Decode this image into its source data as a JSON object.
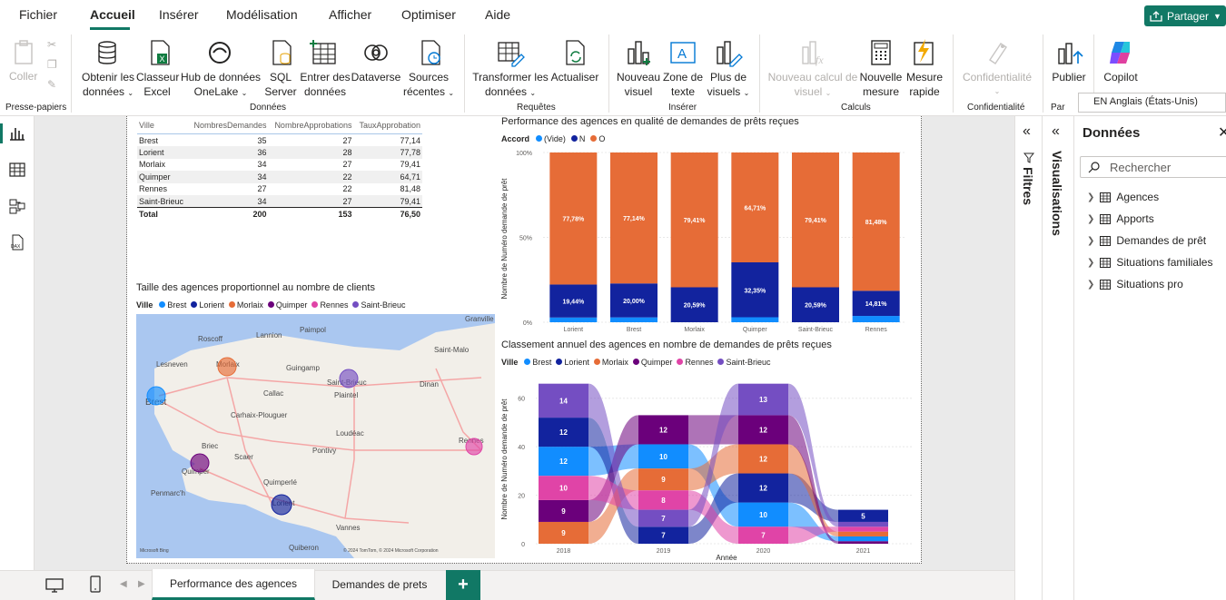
{
  "menu": {
    "items": [
      "Fichier",
      "Accueil",
      "Insérer",
      "Modélisation",
      "Afficher",
      "Optimiser",
      "Aide"
    ],
    "active": "Accueil",
    "share_label": "Partager"
  },
  "ribbon": {
    "coller": "Coller",
    "obtenir": [
      "Obtenir les",
      "données"
    ],
    "classeur": [
      "Classeur",
      "Excel"
    ],
    "hub": [
      "Hub de données",
      "OneLake"
    ],
    "sql": [
      "SQL",
      "Server"
    ],
    "entrer": [
      "Entrer des",
      "données"
    ],
    "dataverse": "Dataverse",
    "sources": [
      "Sources",
      "récentes"
    ],
    "transformer": [
      "Transformer les",
      "données"
    ],
    "actualiser": "Actualiser",
    "nouveau_visuel": [
      "Nouveau",
      "visuel"
    ],
    "zone_texte": [
      "Zone de",
      "texte"
    ],
    "plus_visuels": [
      "Plus de",
      "visuels"
    ],
    "nouveau_calcul": [
      "Nouveau calcul de",
      "visuel"
    ],
    "nouvelle_mesure": [
      "Nouvelle",
      "mesure"
    ],
    "mesure_rapide": [
      "Mesure",
      "rapide"
    ],
    "confidentialite": "Confidentialité",
    "publier": "Publier",
    "copilot": "Copilot",
    "groups": {
      "presse": "Presse-papiers",
      "donnees": "Données",
      "requetes": "Requêtes",
      "inserer": "Insérer",
      "calculs": "Calculs",
      "confidentialite": "Confidentialité",
      "par": "Par"
    },
    "language": "EN Anglais (États-Unis)"
  },
  "table": {
    "headers": [
      "Ville",
      "NombresDemandes",
      "NombreApprobations",
      "TauxApprobation"
    ],
    "rows": [
      [
        "Brest",
        "35",
        "27",
        "77,14"
      ],
      [
        "Lorient",
        "36",
        "28",
        "77,78"
      ],
      [
        "Morlaix",
        "34",
        "27",
        "79,41"
      ],
      [
        "Quimper",
        "34",
        "22",
        "64,71"
      ],
      [
        "Rennes",
        "27",
        "22",
        "81,48"
      ],
      [
        "Saint-Brieuc",
        "34",
        "27",
        "79,41"
      ]
    ],
    "total": [
      "Total",
      "200",
      "153",
      "76,50"
    ]
  },
  "map": {
    "title": "Taille des agences proportionnel au nombre de clients",
    "legend_title": "Ville",
    "places": [
      "Granville",
      "Roscoff",
      "Lannion",
      "Paimpol",
      "Saint-Malo",
      "Lesneven",
      "Morlaix",
      "Guingamp",
      "Saint-Brieuc",
      "Dinan",
      "Brest",
      "Callac",
      "Plaintel",
      "Carhaix-Plouguer",
      "Loudéac",
      "Briec",
      "Scaer",
      "Pontivy",
      "Quimper",
      "Penmarc'h",
      "Quimperlé",
      "Lorient",
      "Vannes",
      "Quiberon",
      "Rennes"
    ],
    "attribution": "© 2024 TomTom, © 2024 Microsoft Corporation",
    "logo": "Microsoft Bing"
  },
  "cities": [
    {
      "name": "Brest",
      "color": "#118dff"
    },
    {
      "name": "Lorient",
      "color": "#12239e"
    },
    {
      "name": "Morlaix",
      "color": "#e66c37"
    },
    {
      "name": "Quimper",
      "color": "#6b007b"
    },
    {
      "name": "Rennes",
      "color": "#e044a7"
    },
    {
      "name": "Saint-Brieuc",
      "color": "#744ec2"
    }
  ],
  "bar_chart": {
    "title": "Performance des agences en qualité de demandes de prêts reçues",
    "legend_title": "Accord",
    "legend": [
      {
        "name": "(Vide)",
        "color": "#118dff"
      },
      {
        "name": "N",
        "color": "#12239e"
      },
      {
        "name": "O",
        "color": "#e66c37"
      }
    ],
    "ylabel": "Nombre de Numéro demande de prêt",
    "yticks": [
      "100%",
      "50%",
      "0%"
    ]
  },
  "ribbon_chart": {
    "title": "Classement annuel des agences en nombre de demandes de prêts reçues",
    "legend_title": "Ville",
    "ylabel": "Nombre de Numéro demande de prêt",
    "xlabel": "Année",
    "yticks": [
      "60",
      "40",
      "20",
      "0"
    ]
  },
  "chart_data": [
    {
      "type": "bar",
      "title": "Performance des agences en qualité de demandes de prêts reçues",
      "categories": [
        "Lorient",
        "Brest",
        "Morlaix",
        "Quimper",
        "Saint-Brieuc",
        "Rennes"
      ],
      "series": [
        {
          "name": "(Vide)",
          "values": [
            2.78,
            2.86,
            0,
            2.94,
            0,
            3.71
          ]
        },
        {
          "name": "N",
          "values": [
            19.44,
            20.0,
            20.59,
            32.35,
            20.59,
            14.81
          ]
        },
        {
          "name": "O",
          "values": [
            77.78,
            77.14,
            79.41,
            64.71,
            79.41,
            81.48
          ]
        }
      ],
      "data_labels": {
        "N": [
          "19,44%",
          "20,00%",
          "20,59%",
          "32,35%",
          "20,59%",
          "14,81%"
        ],
        "O": [
          "77,78%",
          "77,14%",
          "79,41%",
          "64,71%",
          "79,41%",
          "81,48%"
        ]
      },
      "stacked": "100%",
      "ylabel": "Nombre de Numéro demande de prêt",
      "ylim": [
        0,
        100
      ]
    },
    {
      "type": "bar",
      "subtype": "ribbon",
      "title": "Classement annuel des agences en nombre de demandes de prêts reçues",
      "categories": [
        "2018",
        "2019",
        "2020",
        "2021"
      ],
      "series": [
        {
          "name": "Brest",
          "values": [
            12,
            10,
            10,
            2
          ]
        },
        {
          "name": "Lorient",
          "values": [
            12,
            7,
            12,
            5
          ]
        },
        {
          "name": "Morlaix",
          "values": [
            9,
            9,
            12,
            2
          ]
        },
        {
          "name": "Quimper",
          "values": [
            9,
            12,
            12,
            1
          ]
        },
        {
          "name": "Rennes",
          "values": [
            10,
            8,
            7,
            2
          ]
        },
        {
          "name": "Saint-Brieuc",
          "values": [
            14,
            7,
            13,
            2
          ]
        }
      ],
      "data_labels": [
        [
          "14",
          "12",
          "12",
          "10",
          "9",
          "9"
        ],
        [
          "12",
          "10",
          "9",
          "8",
          "7",
          "7"
        ],
        [
          "13",
          "12",
          "12",
          "12",
          "10",
          "7"
        ],
        [
          "5"
        ]
      ],
      "xlabel": "Année",
      "ylabel": "Nombre de Numéro demande de prêt",
      "ylim": [
        0,
        70
      ]
    }
  ],
  "pages": {
    "tab1": "Performance des agences",
    "tab2": "Demandes de prets",
    "add": "+"
  },
  "panels": {
    "filtres": "Filtres",
    "visualisations": "Visualisations",
    "donnees_title": "Données",
    "search_placeholder": "Rechercher",
    "tables": [
      "Agences",
      "Apports",
      "Demandes de prêt",
      "Situations familiales",
      "Situations pro"
    ]
  }
}
